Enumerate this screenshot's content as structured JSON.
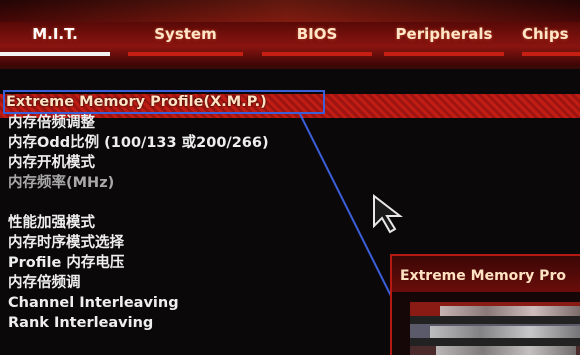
{
  "tabs": [
    {
      "label": "M.I.T.",
      "active": true
    },
    {
      "label": "System",
      "active": false
    },
    {
      "label": "BIOS",
      "active": false
    },
    {
      "label": "Peripherals",
      "active": false
    },
    {
      "label": "Chips",
      "active": false
    }
  ],
  "selected_item": {
    "label": "Extreme Memory Profile(X.M.P.)"
  },
  "menu_items": [
    {
      "label": "内存倍频调整",
      "dim": false
    },
    {
      "label": "内存Odd比例 (100/133 或200/266)",
      "dim": false
    },
    {
      "label": "内存开机模式",
      "dim": false
    },
    {
      "label": "内存频率(MHz)",
      "dim": true
    },
    {
      "label": "性能加强模式",
      "dim": false
    },
    {
      "label": "内存时序模式选择",
      "dim": false
    },
    {
      "label": "Profile 内存电压",
      "dim": false
    },
    {
      "label": "内存倍频调",
      "dim": false
    },
    {
      "label": "Channel Interleaving",
      "dim": false
    },
    {
      "label": "Rank Interleaving",
      "dim": false
    }
  ],
  "popup": {
    "title": "Extreme Memory Pro"
  },
  "colors": {
    "accent_red": "#c62015",
    "selection_border": "#3b5fd8",
    "background": "#0b0809",
    "text": "#eeeeee"
  },
  "icons": [
    "mouse-cursor-icon"
  ]
}
